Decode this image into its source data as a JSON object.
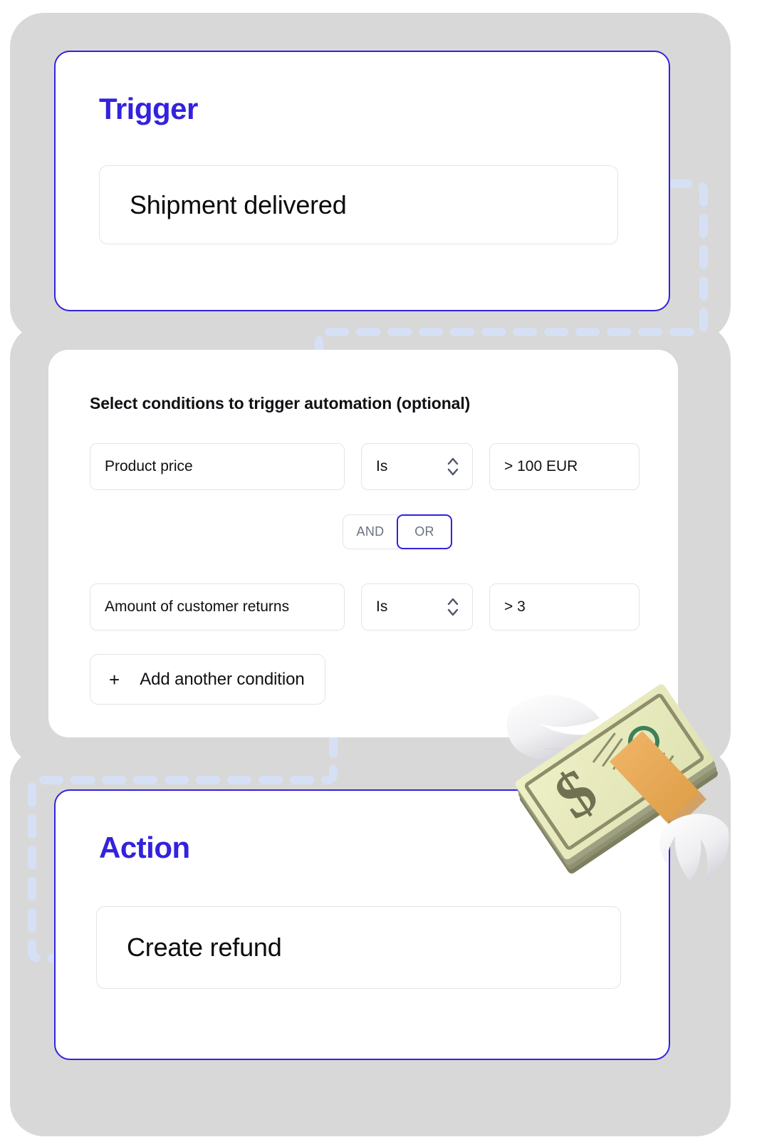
{
  "theme": {
    "accent_blue": "#3322dd",
    "backdrop_gray": "#d8d8d8",
    "card_white": "#ffffff",
    "field_border": "#e2e4e8",
    "connector_blue": "#d6e0f5",
    "muted_text": "#6c7280"
  },
  "trigger": {
    "title": "Trigger",
    "selected_value": "Shipment delivered"
  },
  "conditions": {
    "heading": "Select conditions to trigger automation (optional)",
    "rows": [
      {
        "field": "Product price",
        "operator": "Is",
        "value": "> 100 EUR",
        "stepper_icon": "chevron-up-down-icon"
      },
      {
        "field": "Amount of customer returns",
        "operator": "Is",
        "value": "> 3",
        "stepper_icon": "chevron-up-down-icon"
      }
    ],
    "logic_toggle": {
      "options": [
        "AND",
        "OR"
      ],
      "selected": "OR"
    },
    "add_button": {
      "plus": "+",
      "label": "Add another condition"
    }
  },
  "action": {
    "title": "Action",
    "selected_value": "Create refund"
  },
  "decoration": {
    "emoji_name": "money-with-wings-emoji"
  }
}
